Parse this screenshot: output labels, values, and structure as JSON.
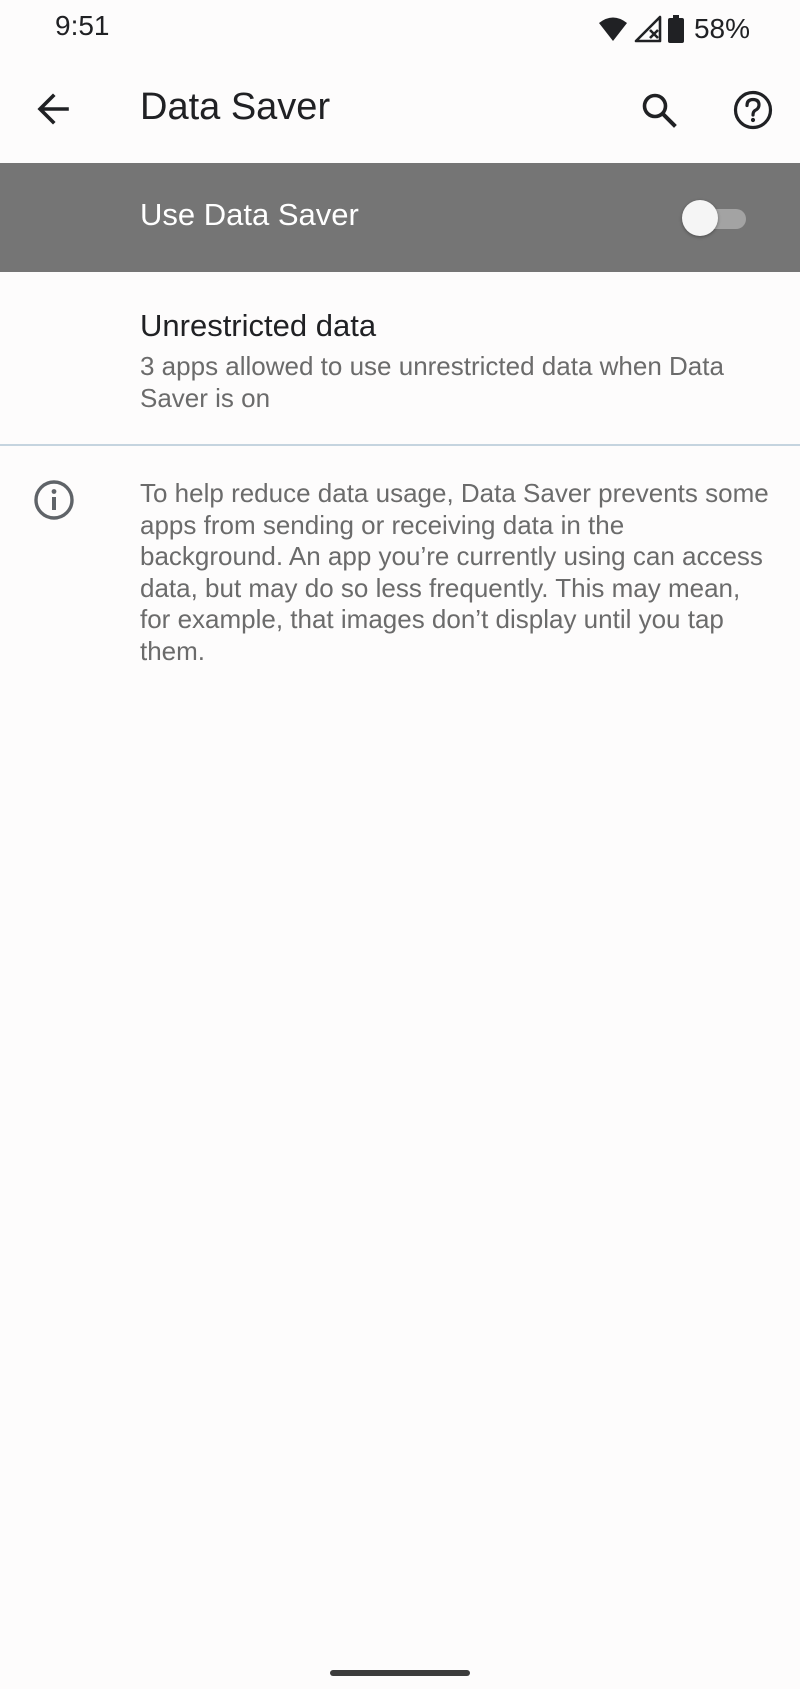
{
  "status_bar": {
    "time": "9:51",
    "battery": "58%",
    "icons": [
      "wifi-icon",
      "cellular-no-signal-icon",
      "battery-icon"
    ]
  },
  "app_bar": {
    "title": "Data Saver",
    "back_icon": "arrow-back-icon",
    "search_icon": "search-icon",
    "help_icon": "help-icon"
  },
  "master_switch": {
    "label": "Use Data Saver",
    "checked": false
  },
  "unrestricted_data": {
    "title": "Unrestricted data",
    "summary": "3 apps allowed to use unrestricted data when Data Saver is on"
  },
  "footer": {
    "icon": "info-icon",
    "text": "To help reduce data usage, Data Saver prevents some apps from sending or receiving data in the background. An app you’re currently using can access data, but may do so less frequently. This may mean, for example, that images don’t display until you tap them."
  },
  "colors": {
    "background": "#fdfcfc",
    "switch_bar": "#757575",
    "primary_text": "#202124",
    "secondary_text": "#6b6b6b",
    "divider": "#c5d4df"
  }
}
